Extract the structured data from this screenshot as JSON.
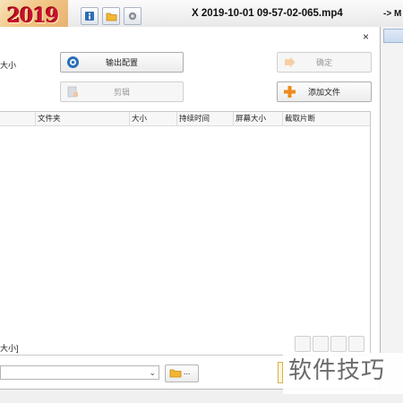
{
  "app": {
    "logo_text": "2019",
    "file_title": "X 2019-10-01 09-57-02-065.mp4",
    "arrow_text": "-> M"
  },
  "dialog": {
    "close_label": "×",
    "label_size": "大小",
    "output_config_label": "输出配置",
    "confirm_label": "确定",
    "clip_label": "剪辑",
    "add_file_label": "添加文件",
    "table_headers": [
      "文件夹",
      "大小",
      "持续时间",
      "屏幕大小",
      "截取片断"
    ],
    "bottom_label": "大小]",
    "combo_value": "",
    "folder_button_label": "..."
  },
  "watermark": "软件技巧",
  "colors": {
    "accent_orange": "#f08a1c",
    "logo_red": "#c8102e"
  }
}
